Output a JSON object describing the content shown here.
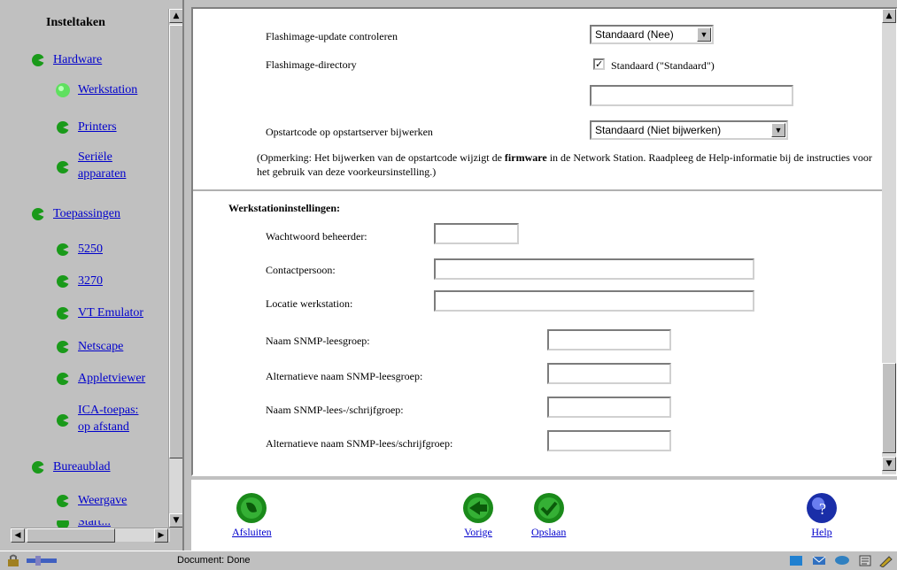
{
  "nav": {
    "title": "Insteltaken",
    "items": [
      {
        "label": "Hardware",
        "level": 0
      },
      {
        "label": "Werkstation",
        "level": 1,
        "active": true
      },
      {
        "label": "Printers",
        "level": 1
      },
      {
        "label": "Seriële apparaten",
        "level": 1
      },
      {
        "label": "Toepassingen",
        "level": 0
      },
      {
        "label": "5250",
        "level": 1
      },
      {
        "label": "3270",
        "level": 1
      },
      {
        "label": "VT Emulator",
        "level": 1
      },
      {
        "label": "Netscape",
        "level": 1
      },
      {
        "label": "Appletviewer",
        "level": 1
      },
      {
        "label": "ICA-toepas: op afstand",
        "level": 1
      },
      {
        "label": "Bureaublad",
        "level": 0
      },
      {
        "label": "Weergave",
        "level": 1
      },
      {
        "label": "Start...",
        "level": 1
      }
    ]
  },
  "form": {
    "flash_update_label": "Flashimage-update controleren",
    "flash_update_value": "Standaard (Nee)",
    "flash_dir_label": "Flashimage-directory",
    "flash_dir_checkbox_label": "Standaard (\"Standaard\")",
    "flash_dir_value": "",
    "bootcode_label": "Opstartcode op opstartserver bijwerken",
    "bootcode_value": "Standaard (Niet bijwerken)",
    "note_pre": "(Opmerking: Het bijwerken van de opstartcode wijzigt de ",
    "note_bold": "firmware",
    "note_post": " in de Network Station. Raadpleeg de Help-informatie bij de instructies voor het gebruik van deze voorkeursinstelling.)",
    "section_title": "Werkstationinstellingen:",
    "admin_pw_label": "Wachtwoord beheerder:",
    "contact_label": "Contactpersoon:",
    "location_label": "Locatie werkstation:",
    "snmp_read_label": "Naam SNMP-leesgroep:",
    "snmp_read_alt_label": "Alternatieve naam SNMP-leesgroep:",
    "snmp_rw_label": "Naam SNMP-lees-/schrijfgroep:",
    "snmp_rw_alt_label": "Alternatieve naam SNMP-lees/schrijfgroep:"
  },
  "toolbar": {
    "close_label": "Afsluiten",
    "prev_label": "Vorige",
    "save_label": "Opslaan",
    "help_label": "Help"
  },
  "status": {
    "text": "Document: Done"
  },
  "colors": {
    "bullet_green": "#1a9a1a",
    "active_green": "#5fe05f",
    "link": "#0000cc",
    "help_blue": "#1a2ea8"
  }
}
